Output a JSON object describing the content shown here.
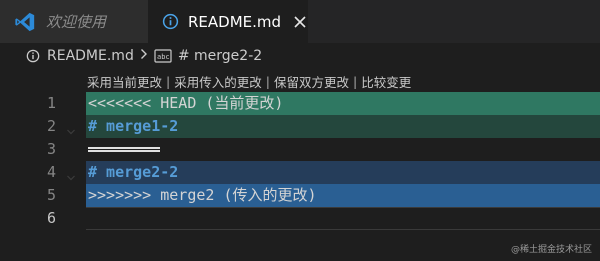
{
  "tabs": [
    {
      "label": "欢迎使用",
      "active": false,
      "icon": "vscode-icon"
    },
    {
      "label": "README.md",
      "active": true,
      "icon": "info-icon"
    }
  ],
  "breadcrumb": {
    "file": "README.md",
    "symbol": "# merge2-2"
  },
  "codelens": [
    "采用当前更改",
    "采用传入的更改",
    "保留双方更改",
    "比较变更"
  ],
  "editor": {
    "line_numbers": [
      "1",
      "2",
      "3",
      "4",
      "5",
      "6"
    ],
    "lines": [
      "<<<<<<< HEAD (当前更改)",
      "# merge1-2",
      "",
      "# merge2-2",
      ">>>>>>> merge2 (传入的更改)",
      ""
    ],
    "active_line": "6"
  },
  "colors": {
    "current_header": "#2f7862",
    "current_body": "#24473d",
    "incoming_body": "#253d5a",
    "incoming_header": "#2a5f93",
    "heading": "#569cd6"
  },
  "watermark": "@稀土掘金技术社区"
}
